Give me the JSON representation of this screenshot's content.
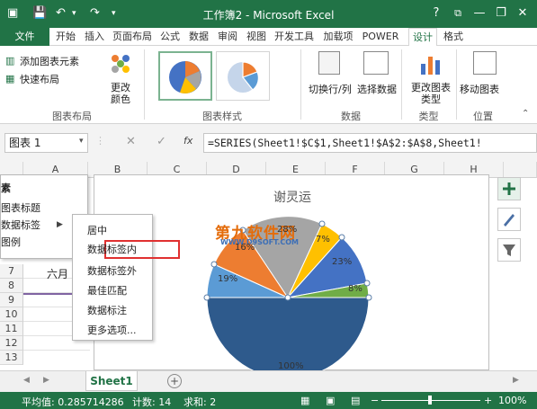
{
  "window": {
    "title": "工作簿2 - Microsoft Excel",
    "controls": [
      "?",
      "⧉",
      "—",
      "❐",
      "✕"
    ]
  },
  "tabs": [
    {
      "label": "文件"
    },
    {
      "label": "开始"
    },
    {
      "label": "插入"
    },
    {
      "label": "页面布局"
    },
    {
      "label": "公式"
    },
    {
      "label": "数据"
    },
    {
      "label": "审阅"
    },
    {
      "label": "视图"
    },
    {
      "label": "开发工具"
    },
    {
      "label": "加载项"
    },
    {
      "label": "POWER"
    },
    {
      "label": "设计"
    },
    {
      "label": "格式"
    }
  ],
  "ribbon": {
    "add_element": "添加图表元素",
    "quick_layout": "快速布局",
    "change_colors": "更改颜色",
    "group_layout": "图表布局",
    "group_styles": "图表样式",
    "switch_row_col": "切换行/列",
    "select_data": "选择数据",
    "group_data": "数据",
    "change_type": "更改图表类型",
    "group_type": "类型",
    "move_chart": "移动图表",
    "group_location": "位置"
  },
  "formula_bar": {
    "name_box": "图表 1",
    "fx": "fx",
    "formula": "=SERIES(Sheet1!$C$1,Sheet1!$A$2:$A$8,Sheet1!"
  },
  "columns": [
    "A",
    "B",
    "C",
    "D",
    "E",
    "F",
    "G",
    "H"
  ],
  "rows": [
    "7",
    "8",
    "9",
    "10",
    "11",
    "12",
    "13"
  ],
  "cells": {
    "a7": "六月"
  },
  "chart": {
    "title": "谢灵运",
    "watermark_main": "第九软件网",
    "watermark_url": "WWW.D9SOFT.COM",
    "slices": [
      {
        "label": "100%",
        "color": "#2e5a8c"
      },
      {
        "label": "19%",
        "color": "#5b9bd5"
      },
      {
        "label": "16%",
        "color": "#ed7d31"
      },
      {
        "label": "28%",
        "color": "#a5a5a5"
      },
      {
        "label": "7%",
        "color": "#ffc000"
      },
      {
        "label": "23%",
        "color": "#4472c4"
      },
      {
        "label": "8%",
        "color": "#70ad47"
      }
    ]
  },
  "menu1": {
    "items": [
      "素",
      "图表标题",
      "数据标签",
      "图例"
    ]
  },
  "menu2": {
    "items": [
      "居中",
      "数据标签内",
      "数据标签外",
      "最佳匹配",
      "数据标注",
      "更多选项..."
    ]
  },
  "sheet_tab": "Sheet1",
  "status": {
    "average": "平均值: 0.285714286",
    "count": "计数: 14",
    "sum": "求和: 2",
    "zoom": "100%"
  }
}
